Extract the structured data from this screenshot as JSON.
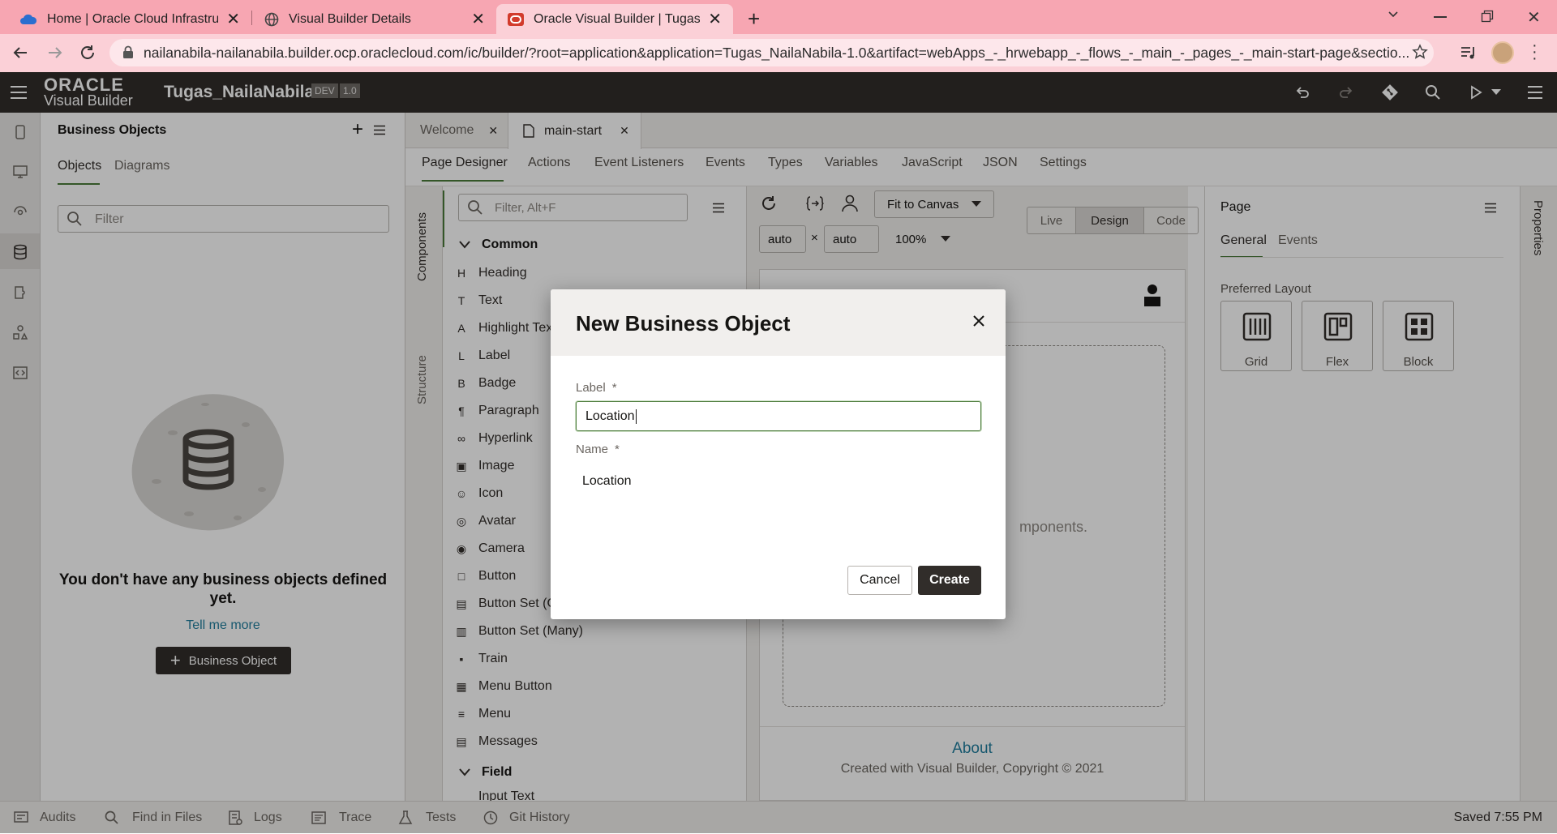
{
  "browser": {
    "tabs": [
      {
        "title": "Home | Oracle Cloud Infrastructu",
        "close": "✕"
      },
      {
        "title": "Visual Builder Details",
        "close": "✕"
      },
      {
        "title": "Oracle Visual Builder | Tugas_Nai",
        "close": "✕"
      }
    ],
    "url": "nailanabila-nailanabila.builder.ocp.oraclecloud.com/ic/builder/?root=application&application=Tugas_NailaNabila-1.0&artifact=webApps_-_hrwebapp_-_flows_-_main_-_pages_-_main-start-page&sectio..."
  },
  "app": {
    "logo_top": "ORACLE",
    "logo_bottom": "Visual Builder",
    "name": "Tugas_NailaNabila",
    "badge_env": "DEV",
    "badge_version": "1.0"
  },
  "bo_panel": {
    "title": "Business Objects",
    "tabs": [
      "Objects",
      "Diagrams"
    ],
    "filter_placeholder": "Filter",
    "empty_message": "You don't have any business objects defined yet.",
    "tell_me_more": "Tell me more",
    "add_button": "Business Object"
  },
  "editor": {
    "file_tabs": [
      "Welcome",
      "main-start"
    ],
    "subtabs": [
      "Page Designer",
      "Actions",
      "Event Listeners",
      "Events",
      "Types",
      "Variables",
      "JavaScript",
      "JSON",
      "Settings"
    ],
    "side_tabs": [
      "Components",
      "Structure"
    ],
    "comp_filter_placeholder": "Filter, Alt+F",
    "category_common": "Common",
    "category_field": "Field",
    "components": [
      "Heading",
      "Text",
      "Highlight Text",
      "Label",
      "Badge",
      "Paragraph",
      "Hyperlink",
      "Image",
      "Icon",
      "Avatar",
      "Camera",
      "Button",
      "Button Set (One)",
      "Button Set (Many)",
      "Train",
      "Menu Button",
      "Menu",
      "Messages"
    ],
    "partial_item": "Input Text",
    "fit_to_canvas": "Fit to Canvas",
    "width_value": "auto",
    "height_value": "auto",
    "times": "×",
    "zoom": "100%",
    "modes": [
      "Live",
      "Design",
      "Code"
    ],
    "canvas_placeholder": "Drop components here. Drag and drop components.",
    "canvas_partial": "mponents.",
    "footer_link": "About",
    "footer_text": "Created with Visual Builder, Copyright © 2021"
  },
  "properties": {
    "title": "Page",
    "tabs": [
      "General",
      "Events"
    ],
    "section_label": "Preferred Layout",
    "layouts": [
      "Grid",
      "Flex",
      "Block"
    ],
    "side_tab": "Properties"
  },
  "status_bar": {
    "items": [
      "Audits",
      "Find in Files",
      "Logs",
      "Trace",
      "Tests",
      "Git History"
    ],
    "saved": "Saved 7:55 PM"
  },
  "dialog": {
    "title": "New Business Object",
    "label_field_label": "Label",
    "label_value": "Location",
    "name_field_label": "Name",
    "name_value": "Location",
    "required_mark": "*",
    "cancel": "Cancel",
    "create": "Create"
  },
  "colors": {
    "browser_tabbar": "#f7a6b2",
    "browser_toolbar": "#fbd0d7",
    "app_header": "#312d2a",
    "accent_dark": "#312d2a",
    "link_teal": "#227e9e",
    "focus_green": "#4b7b3a"
  }
}
